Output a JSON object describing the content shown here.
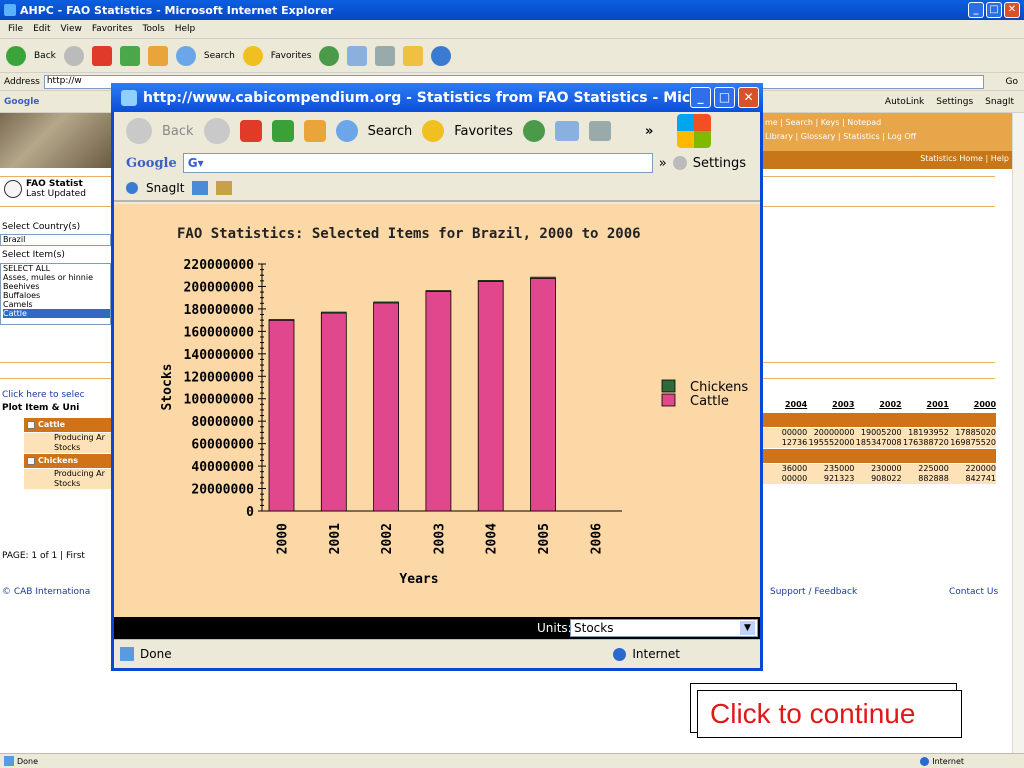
{
  "outer": {
    "title": "AHPC - FAO Statistics - Microsoft Internet Explorer",
    "menu": [
      "File",
      "Edit",
      "View",
      "Favorites",
      "Tools",
      "Help"
    ],
    "toolbar": {
      "back": "Back",
      "search": "Search",
      "favorites": "Favorites"
    },
    "address_label": "Address",
    "address_value": "http://w",
    "go": "Go",
    "google_label": "Google",
    "autolink": "AutoLink",
    "settings": "Settings",
    "snagit": "SnagIt",
    "status": "Done",
    "zone": "Internet"
  },
  "page": {
    "nav": [
      "me",
      "Search",
      "Keys",
      "Notepad",
      "Library",
      "Glossary",
      "Statistics",
      "Log Off"
    ],
    "nav2": "Statistics Home  |  Help",
    "fao_title": "FAO Statist",
    "fao_sub": "Last Updated",
    "select_country_label": "Select Country(s)",
    "country_value": "Brazil",
    "select_item_label": "Select Item(s)",
    "items": [
      "SELECT ALL",
      "Asses, mules or hinnie",
      "Beehives",
      "Buffaloes",
      "Camels",
      "Cattle"
    ],
    "click_here": "Click here to selec",
    "plot_header": "Plot Item & Uni",
    "groups": [
      {
        "name": "Cattle",
        "rows": [
          "Producing Ar",
          "Stocks"
        ]
      },
      {
        "name": "Chickens",
        "rows": [
          "Producing Ar",
          "Stocks"
        ]
      }
    ],
    "table_headers": [
      "2004",
      "2003",
      "2002",
      "2001",
      "2000"
    ],
    "table_rows": [
      [
        "00000",
        "20000000",
        "19005200",
        "18193952",
        "17885020"
      ],
      [
        "12736",
        "195552000",
        "185347008",
        "176388720",
        "169875520"
      ],
      [
        "36000",
        "235000",
        "230000",
        "225000",
        "220000"
      ],
      [
        "00000",
        "921323",
        "908022",
        "882888",
        "842741"
      ]
    ],
    "pager": "PAGE: 1 of 1 | First",
    "copyright": "© CAB Internationa",
    "support": "Support / Feedback",
    "contact": "Contact Us"
  },
  "popup": {
    "title": "http://www.cabicompendium.org - Statistics from FAO Statistics - Microsoft Inte...",
    "back": "Back",
    "search": "Search",
    "favorites": "Favorites",
    "google_label": "Google",
    "settings": "Settings",
    "snagit": "SnagIt",
    "units_label": "Units:",
    "units_value": "Stocks",
    "status": "Done",
    "zone": "Internet"
  },
  "chart_data": {
    "type": "bar",
    "title": "FAO Statistics: Selected Items for Brazil, 2000 to 2006",
    "xlabel": "Years",
    "ylabel": "Stocks",
    "categories": [
      "2000",
      "2001",
      "2002",
      "2003",
      "2004",
      "2005",
      "2006"
    ],
    "ylim": [
      0,
      220000000
    ],
    "yticks": [
      0,
      20000000,
      40000000,
      60000000,
      80000000,
      100000000,
      120000000,
      140000000,
      160000000,
      180000000,
      200000000,
      220000000
    ],
    "stacked": true,
    "series": [
      {
        "name": "Cattle",
        "color": "#e0478d",
        "values": [
          169875520,
          176388720,
          185347008,
          195552000,
          204512736,
          207200000,
          null
        ]
      },
      {
        "name": "Chickens",
        "color": "#2f6b3a",
        "values": [
          842741,
          882888,
          908022,
          921323,
          1000000,
          1200000,
          null
        ]
      }
    ],
    "legend": [
      "Chickens",
      "Cattle"
    ],
    "legend_position": "right"
  },
  "cta": {
    "label": "Click to continue"
  }
}
